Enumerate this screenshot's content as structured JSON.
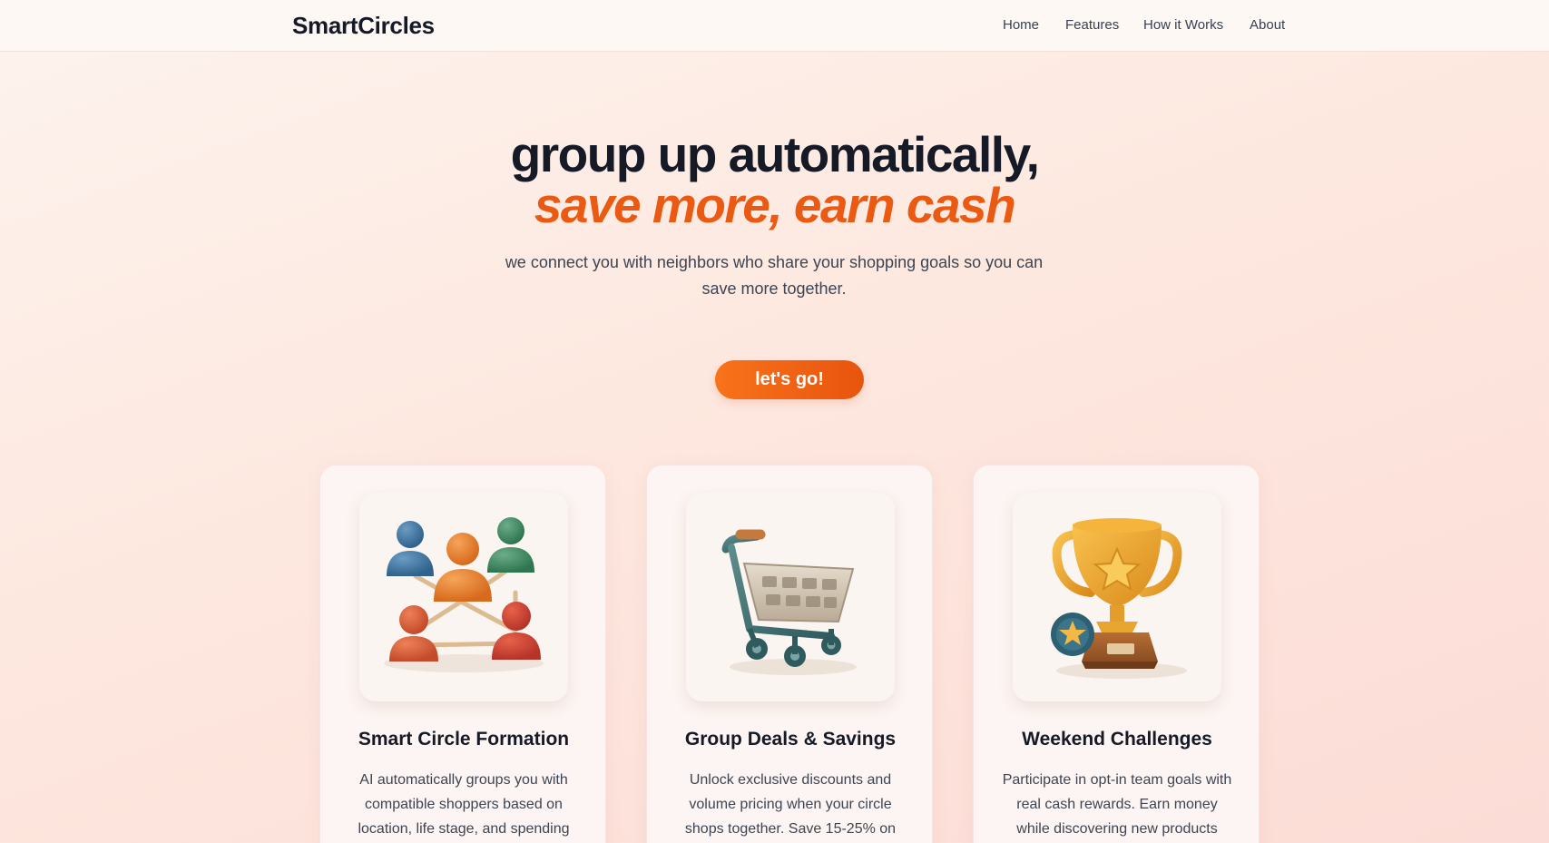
{
  "nav": {
    "brand": "SmartCircles",
    "links": [
      "Home",
      "Features",
      "How it Works",
      "About"
    ]
  },
  "hero": {
    "title": "group up automatically,",
    "accent": "save more, earn cash",
    "subtitle": "we connect you with neighbors who share your shopping goals so you can save more together.",
    "cta_label": "let's go!"
  },
  "features": [
    {
      "icon": "people-network-icon",
      "title": "Smart Circle Formation",
      "description": "AI automatically groups you with compatible shoppers based on location, life stage, and spending"
    },
    {
      "icon": "shopping-cart-icon",
      "title": "Group Deals & Savings",
      "description": "Unlock exclusive discounts and volume pricing when your circle shops together. Save 15-25% on"
    },
    {
      "icon": "trophy-icon",
      "title": "Weekend Challenges",
      "description": "Participate in opt-in team goals with real cash rewards. Earn money while discovering new products"
    }
  ],
  "colors": {
    "accent": "#ea5a12",
    "heading": "#151a26",
    "body_text": "#3d4452",
    "button_start": "#f8731a",
    "button_end": "#e8540e"
  }
}
